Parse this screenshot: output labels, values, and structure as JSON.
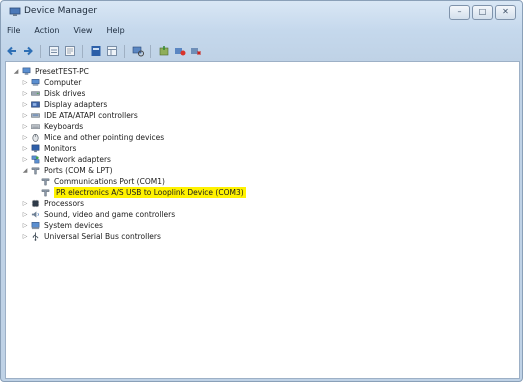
{
  "window": {
    "title": "Device Manager",
    "minimize": "–",
    "maximize": "□",
    "close": "✕"
  },
  "menu": [
    "File",
    "Action",
    "View",
    "Help"
  ],
  "toolbar": [
    "back-icon",
    "forward-icon",
    "up-icon",
    "properties-icon",
    "help-icon",
    "view-icon",
    "scan-icon",
    "update-driver-icon",
    "disable-icon",
    "uninstall-icon"
  ],
  "tree": {
    "root": "PresetTEST-PC",
    "items": [
      {
        "label": "Computer",
        "icon": "computer-icon",
        "expanded": false
      },
      {
        "label": "Disk drives",
        "icon": "disk-drive-icon",
        "expanded": false
      },
      {
        "label": "Display adapters",
        "icon": "display-adapter-icon",
        "expanded": false
      },
      {
        "label": "IDE ATA/ATAPI controllers",
        "icon": "ide-controller-icon",
        "expanded": false
      },
      {
        "label": "Keyboards",
        "icon": "keyboard-icon",
        "expanded": false
      },
      {
        "label": "Mice and other pointing devices",
        "icon": "mouse-icon",
        "expanded": false
      },
      {
        "label": "Monitors",
        "icon": "monitor-icon",
        "expanded": false
      },
      {
        "label": "Network adapters",
        "icon": "network-adapter-icon",
        "expanded": false
      },
      {
        "label": "Ports (COM & LPT)",
        "icon": "port-icon",
        "expanded": true,
        "children": [
          {
            "label": "Communications Port (COM1)",
            "icon": "port-icon",
            "highlight": false
          },
          {
            "label": "PR electronics A/S USB to Looplink Device (COM3)",
            "icon": "port-icon",
            "highlight": true
          }
        ]
      },
      {
        "label": "Processors",
        "icon": "processor-icon",
        "expanded": false
      },
      {
        "label": "Sound, video and game controllers",
        "icon": "sound-icon",
        "expanded": false
      },
      {
        "label": "System devices",
        "icon": "system-devices-icon",
        "expanded": false
      },
      {
        "label": "Universal Serial Bus controllers",
        "icon": "usb-icon",
        "expanded": false
      }
    ]
  },
  "colors": {
    "highlight": "#fff200",
    "titlebar": "#c5d8ec"
  }
}
